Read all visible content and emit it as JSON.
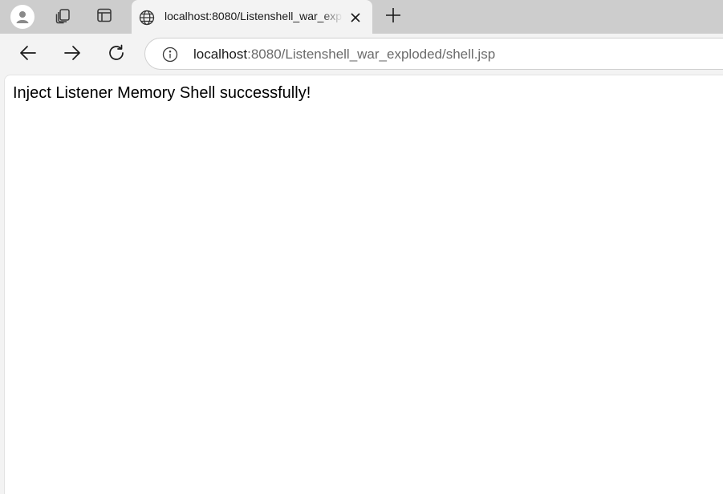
{
  "tab": {
    "title": "localhost:8080/Listenshell_war_exploded/shell.jsp"
  },
  "address_bar": {
    "host": "localhost",
    "rest": ":8080/Listenshell_war_exploded/shell.jsp"
  },
  "page": {
    "message": "Inject Listener Memory Shell successfully!"
  },
  "icons": {
    "profile": "profile-icon",
    "workspaces": "workspaces-icon",
    "vertical_tabs": "vertical-tabs-icon",
    "favicon": "globe-icon",
    "close_tab": "close-icon",
    "new_tab": "plus-icon",
    "back": "arrow-left-icon",
    "forward": "arrow-right-icon",
    "reload": "reload-icon",
    "site_info": "info-icon"
  },
  "colors": {
    "tabstrip_bg": "#cdcdcd",
    "active_tab_bg": "#f3f3f3",
    "page_bg": "#ffffff",
    "url_host": "#1a1a1a",
    "url_rest": "#6b6b6b"
  }
}
